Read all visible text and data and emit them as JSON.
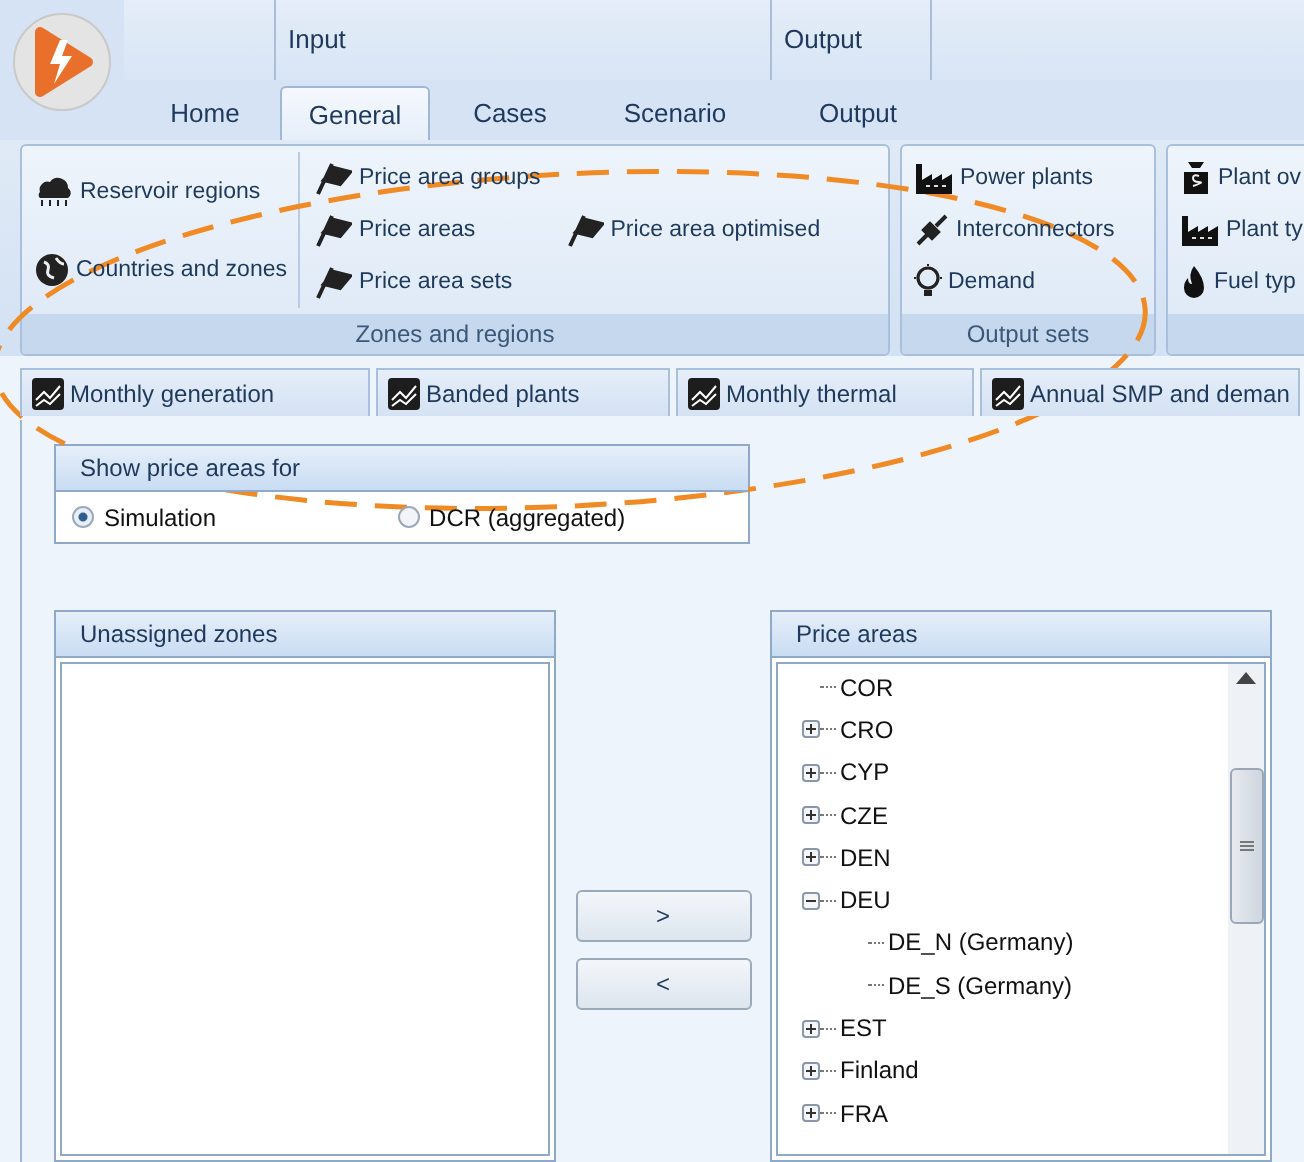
{
  "ribbon": {
    "groups_header": [
      "Input",
      "Output"
    ],
    "tabs": [
      {
        "label": "Home",
        "selected": false
      },
      {
        "label": "General",
        "selected": true
      },
      {
        "label": "Cases",
        "selected": false
      },
      {
        "label": "Scenario",
        "selected": false
      },
      {
        "label": "Output",
        "selected": false
      }
    ],
    "groups": [
      {
        "title": "Zones and regions",
        "columns": [
          [
            "Reservoir  regions",
            "Countries and zones"
          ],
          [
            "Price area groups",
            "Price areas",
            "Price area sets"
          ],
          [
            "Price area optimised"
          ]
        ]
      },
      {
        "title": "Output sets",
        "columns": [
          [
            "Power plants",
            "Interconnectors",
            "Demand"
          ]
        ]
      },
      {
        "columns": [
          [
            "Plant ov",
            "Plant ty",
            "Fuel typ"
          ]
        ]
      }
    ]
  },
  "doc_tabs": [
    "Monthly generation",
    "Banded plants",
    "Monthly thermal",
    "Annual SMP and deman"
  ],
  "show_for": {
    "title": "Show price areas for",
    "options": [
      {
        "label": "Simulation",
        "selected": true
      },
      {
        "label": "DCR (aggregated)",
        "selected": false
      }
    ]
  },
  "unassigned": {
    "title": "Unassigned zones"
  },
  "move_buttons": [
    ">",
    "<"
  ],
  "price_areas": {
    "title": "Price areas",
    "items": [
      {
        "label": "COR"
      },
      {
        "label": "CRO",
        "expanded": false
      },
      {
        "label": "CYP",
        "expanded": false
      },
      {
        "label": "CZE",
        "expanded": false
      },
      {
        "label": "DEN",
        "expanded": false
      },
      {
        "label": "DEU",
        "expanded": true,
        "children": [
          {
            "label": "DE_N (Germany)"
          },
          {
            "label": "DE_S (Germany)"
          }
        ]
      },
      {
        "label": "EST",
        "expanded": false
      },
      {
        "label": "Finland",
        "expanded": false
      },
      {
        "label": "FRA",
        "expanded": false
      }
    ]
  }
}
